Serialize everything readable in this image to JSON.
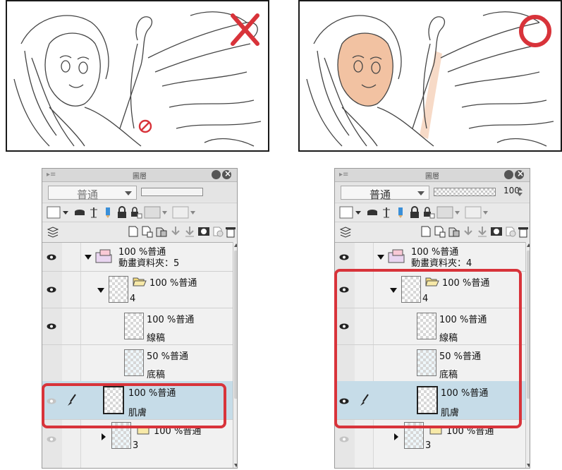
{
  "left": {
    "panel_title": "圖層",
    "blend_mode": "普通",
    "folder_row": {
      "line1": "100 %普通",
      "line2": "動畫資料夾：5"
    },
    "layers": [
      {
        "percent": "100 %",
        "mode": "普通",
        "name": "4"
      },
      {
        "percent": "100 %",
        "mode": "普通",
        "name": "線稿"
      },
      {
        "percent": "50 %",
        "mode": "普通",
        "name": "底稿"
      },
      {
        "percent": "100 %",
        "mode": "普通",
        "name": "肌膚"
      },
      {
        "percent": "100 %",
        "mode": "普通",
        "name": "3"
      }
    ]
  },
  "right": {
    "panel_title": "圖層",
    "blend_mode": "普通",
    "opacity_value": "100",
    "folder_row": {
      "line1": "100 %普通",
      "line2": "動畫資料夾：4"
    },
    "layers": [
      {
        "percent": "100 %",
        "mode": "普通",
        "name": "4"
      },
      {
        "percent": "100 %",
        "mode": "普通",
        "name": "線稿"
      },
      {
        "percent": "50 %",
        "mode": "普通",
        "name": "底稿"
      },
      {
        "percent": "100 %",
        "mode": "普通",
        "name": "肌膚"
      },
      {
        "percent": "100 %",
        "mode": "普通",
        "name": "3"
      }
    ]
  },
  "colors": {
    "highlight": "#d8333a",
    "selected_row": "#c6dce8",
    "skin": "#f2c2a2"
  }
}
